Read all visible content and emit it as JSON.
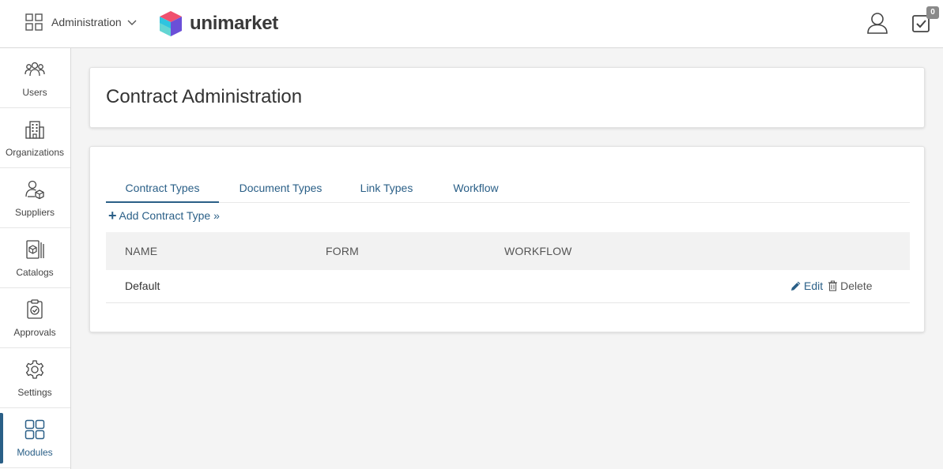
{
  "header": {
    "app_switch_label": "Administration",
    "brand": "unimarket",
    "tasks_count": "0"
  },
  "sidebar": {
    "items": [
      {
        "label": "Users"
      },
      {
        "label": "Organizations"
      },
      {
        "label": "Suppliers"
      },
      {
        "label": "Catalogs"
      },
      {
        "label": "Approvals"
      },
      {
        "label": "Settings"
      },
      {
        "label": "Modules"
      }
    ],
    "active": "Modules"
  },
  "page": {
    "title": "Contract Administration"
  },
  "tabs": [
    {
      "label": "Contract Types",
      "active": true
    },
    {
      "label": "Document Types",
      "active": false
    },
    {
      "label": "Link Types",
      "active": false
    },
    {
      "label": "Workflow",
      "active": false
    }
  ],
  "add_link": "Add Contract Type »",
  "table": {
    "columns": [
      "NAME",
      "FORM",
      "WORKFLOW"
    ],
    "rows": [
      {
        "name": "Default",
        "form": "",
        "workflow": ""
      }
    ],
    "actions": {
      "edit": "Edit",
      "delete": "Delete"
    }
  },
  "colors": {
    "accent": "#2a5f87",
    "logo_pink": "#f0506e",
    "logo_cyan": "#2ec4e0",
    "logo_purple": "#6b4fd8"
  }
}
